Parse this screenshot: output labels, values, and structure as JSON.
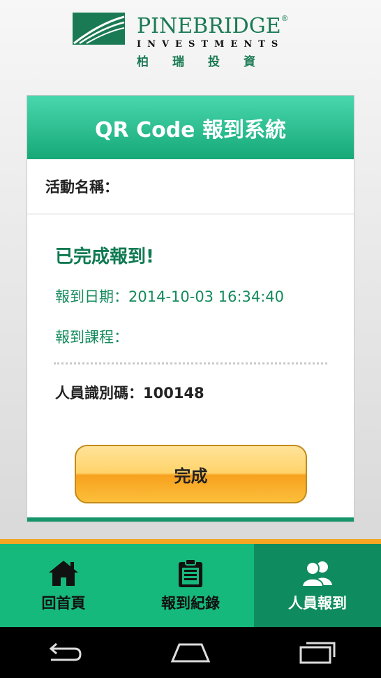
{
  "brand": {
    "name": "PINEBRIDGE",
    "mark": "®",
    "sub": "INVESTMENTS",
    "chinese": "柏瑞投資",
    "color": "#1a7a53"
  },
  "card": {
    "title": "QR Code 報到系統",
    "event_label": "活動名稱：",
    "status": "已完成報到!",
    "date_line": "報到日期：2014-10-03 16:34:40",
    "course_line": "報到課程：",
    "id_line": "人員識別碼：100148",
    "done_button": "完成"
  },
  "tabs": [
    {
      "label": "回首頁",
      "icon": "home-icon",
      "active": false
    },
    {
      "label": "報到紀錄",
      "icon": "clipboard-icon",
      "active": false
    },
    {
      "label": "人員報到",
      "icon": "people-icon",
      "active": true
    }
  ],
  "system_nav": {
    "back": "back-icon",
    "home": "home-nav-icon",
    "recents": "recents-icon"
  },
  "colors": {
    "header": "#16a877",
    "tabbar": "#16b97c",
    "accent": "#f5a623",
    "button": "#ffd36a"
  }
}
